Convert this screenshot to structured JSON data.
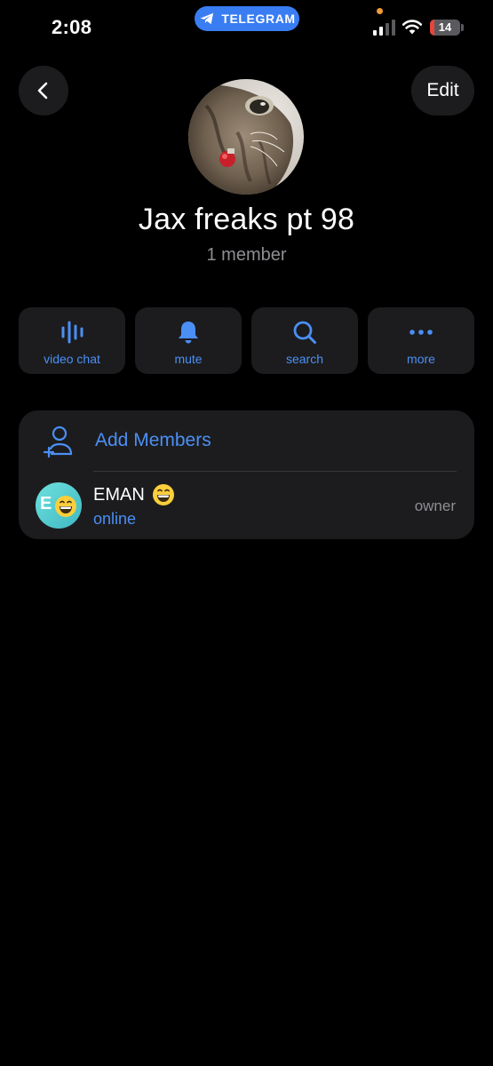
{
  "status_bar": {
    "time": "2:08",
    "app_pill_label": "TELEGRAM",
    "battery_level": "14",
    "battery_fraction": 0.14,
    "colors": {
      "pill": "#3a7df2",
      "battery_low": "#e5453a",
      "recording_dot": "#f19a37"
    }
  },
  "header": {
    "back_icon": "chevron-left-icon",
    "edit_label": "Edit"
  },
  "group": {
    "title": "Jax freaks pt 98",
    "subtitle": "1 member",
    "avatar_description": "cat-photo"
  },
  "actions": [
    {
      "label": "video chat",
      "icon": "voice-chat-icon"
    },
    {
      "label": "mute",
      "icon": "bell-icon"
    },
    {
      "label": "search",
      "icon": "search-icon"
    },
    {
      "label": "more",
      "icon": "more-dots-icon"
    }
  ],
  "members": {
    "add_label": "Add Members",
    "add_icon": "add-person-icon",
    "list": [
      {
        "name": "EMAN",
        "name_emoji": "grinning-face",
        "avatar_letter": "E",
        "status": "online",
        "role": "owner"
      }
    ]
  },
  "theme": {
    "background": "#000000",
    "surface": "#1c1c1e",
    "accent": "#4b8ff5",
    "secondary_text": "#8e8e93"
  }
}
